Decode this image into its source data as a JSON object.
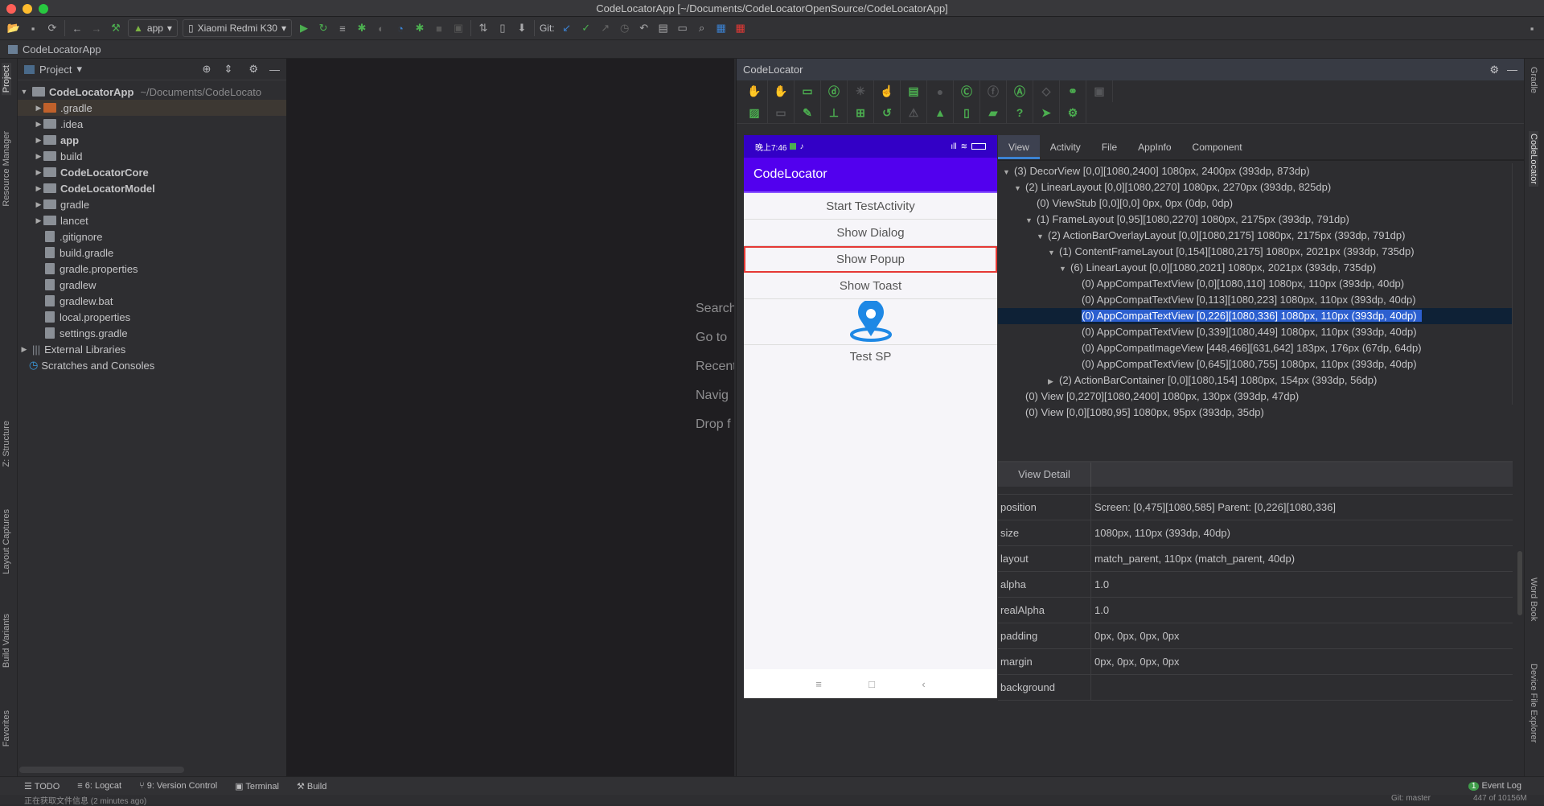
{
  "window": {
    "title": "CodeLocatorApp [~/Documents/CodeLocatorOpenSource/CodeLocatorApp]"
  },
  "toolbar": {
    "run_config": "app",
    "device": "Xiaomi Redmi K30",
    "git_label": "Git:"
  },
  "breadcrumb": {
    "project": "CodeLocatorApp"
  },
  "left_strip": [
    "Project",
    "Resource Manager",
    "Z: Structure",
    "Layout Captures",
    "Build Variants",
    "Favorites"
  ],
  "project": {
    "title": "Project",
    "root": {
      "name": "CodeLocatorApp",
      "path": "~/Documents/CodeLocato"
    },
    "items": [
      {
        "name": ".gradle",
        "type": "folder",
        "color": "#c0612b",
        "expandable": true
      },
      {
        "name": ".idea",
        "type": "folder",
        "expandable": true
      },
      {
        "name": "app",
        "type": "folder",
        "bold": true,
        "expandable": true
      },
      {
        "name": "build",
        "type": "folder",
        "expandable": true
      },
      {
        "name": "CodeLocatorCore",
        "type": "folder",
        "bold": true,
        "expandable": true
      },
      {
        "name": "CodeLocatorModel",
        "type": "folder",
        "bold": true,
        "expandable": true
      },
      {
        "name": "gradle",
        "type": "folder",
        "expandable": true
      },
      {
        "name": "lancet",
        "type": "folder",
        "expandable": true
      },
      {
        "name": ".gitignore",
        "type": "file"
      },
      {
        "name": "build.gradle",
        "type": "file"
      },
      {
        "name": "gradle.properties",
        "type": "file"
      },
      {
        "name": "gradlew",
        "type": "file"
      },
      {
        "name": "gradlew.bat",
        "type": "file"
      },
      {
        "name": "local.properties",
        "type": "file"
      },
      {
        "name": "settings.gradle",
        "type": "file"
      }
    ],
    "external": "External Libraries",
    "scratches": "Scratches and Consoles"
  },
  "editor_hints": [
    "Search",
    "Go to",
    "Recent",
    "Navig",
    "Drop f"
  ],
  "codelocator": {
    "title": "CodeLocator",
    "phone": {
      "time": "晚上7:46",
      "app_title": "CodeLocator",
      "buttons": [
        "Start TestActivity",
        "Show Dialog",
        "Show Popup",
        "Show Toast"
      ],
      "image_label": "Test SP",
      "nav": [
        "≡",
        "□",
        "‹"
      ]
    },
    "tabs": [
      "View",
      "Activity",
      "File",
      "AppInfo",
      "Component"
    ],
    "tree": [
      {
        "d": 0,
        "e": "down",
        "t": "(3) DecorView [0,0][1080,2400]  1080px, 2400px (393dp, 873dp)"
      },
      {
        "d": 1,
        "e": "down",
        "t": "(2) LinearLayout [0,0][1080,2270]  1080px, 2270px (393dp, 825dp)"
      },
      {
        "d": 2,
        "e": "",
        "t": "(0) ViewStub [0,0][0,0]  0px, 0px (0dp, 0dp)"
      },
      {
        "d": 2,
        "e": "down",
        "t": "(1) FrameLayout [0,95][1080,2270]  1080px, 2175px (393dp, 791dp)"
      },
      {
        "d": 3,
        "e": "down",
        "t": "(2) ActionBarOverlayLayout [0,0][1080,2175]  1080px, 2175px (393dp, 791dp)"
      },
      {
        "d": 4,
        "e": "down",
        "t": "(1) ContentFrameLayout [0,154][1080,2175]  1080px, 2021px (393dp, 735dp)"
      },
      {
        "d": 5,
        "e": "down",
        "t": "(6) LinearLayout [0,0][1080,2021]  1080px, 2021px (393dp, 735dp)"
      },
      {
        "d": 6,
        "e": "",
        "t": "(0) AppCompatTextView [0,0][1080,110]  1080px, 110px (393dp, 40dp)"
      },
      {
        "d": 6,
        "e": "",
        "t": "(0) AppCompatTextView [0,113][1080,223]  1080px, 110px (393dp, 40dp)"
      },
      {
        "d": 6,
        "e": "",
        "t": "(0) AppCompatTextView [0,226][1080,336]  1080px, 110px (393dp, 40dp)",
        "sel": true
      },
      {
        "d": 6,
        "e": "",
        "t": "(0) AppCompatTextView [0,339][1080,449]  1080px, 110px (393dp, 40dp)"
      },
      {
        "d": 6,
        "e": "",
        "t": "(0) AppCompatImageView [448,466][631,642]  183px, 176px (67dp, 64dp)"
      },
      {
        "d": 6,
        "e": "",
        "t": "(0) AppCompatTextView [0,645][1080,755]  1080px, 110px (393dp, 40dp)"
      },
      {
        "d": 4,
        "e": "right",
        "t": "(2) ActionBarContainer [0,0][1080,154]  1080px, 154px (393dp, 56dp)"
      },
      {
        "d": 1,
        "e": "",
        "t": "(0) View [0,2270][1080,2400]  1080px, 130px (393dp, 47dp)"
      },
      {
        "d": 1,
        "e": "",
        "t": "(0) View [0,0][1080,95]  1080px, 95px (393dp, 35dp)"
      }
    ],
    "detail": {
      "title": "View Detail",
      "rows": [
        {
          "k": "position",
          "v": "Screen: [0,475][1080,585] Parent: [0,226][1080,336]"
        },
        {
          "k": "size",
          "v": "1080px, 110px (393dp, 40dp)"
        },
        {
          "k": "layout",
          "v": "match_parent, 110px (match_parent, 40dp)"
        },
        {
          "k": "alpha",
          "v": "1.0"
        },
        {
          "k": "realAlpha",
          "v": "1.0"
        },
        {
          "k": "padding",
          "v": "0px, 0px, 0px, 0px"
        },
        {
          "k": "margin",
          "v": "0px, 0px, 0px, 0px"
        },
        {
          "k": "background",
          "v": ""
        }
      ]
    }
  },
  "right_strip": [
    "Gradle",
    "CodeLocator",
    "Word Book",
    "Device File Explorer"
  ],
  "bottom_tools": [
    "TODO",
    "6: Logcat",
    "9: Version Control",
    "Terminal",
    "Build"
  ],
  "event_log": {
    "count": "1",
    "label": "Event Log"
  },
  "status": {
    "message": "正在获取文件信息 (2 minutes ago)",
    "git": "Git: master",
    "memory": "447 of 10156M"
  },
  "colors": {
    "accent": "#3b83d4",
    "app_bar": "#5200ee",
    "status_bar": "#3300c6",
    "highlight": "#e53935",
    "pin": "#1e88e5",
    "green": "#4caf50"
  }
}
